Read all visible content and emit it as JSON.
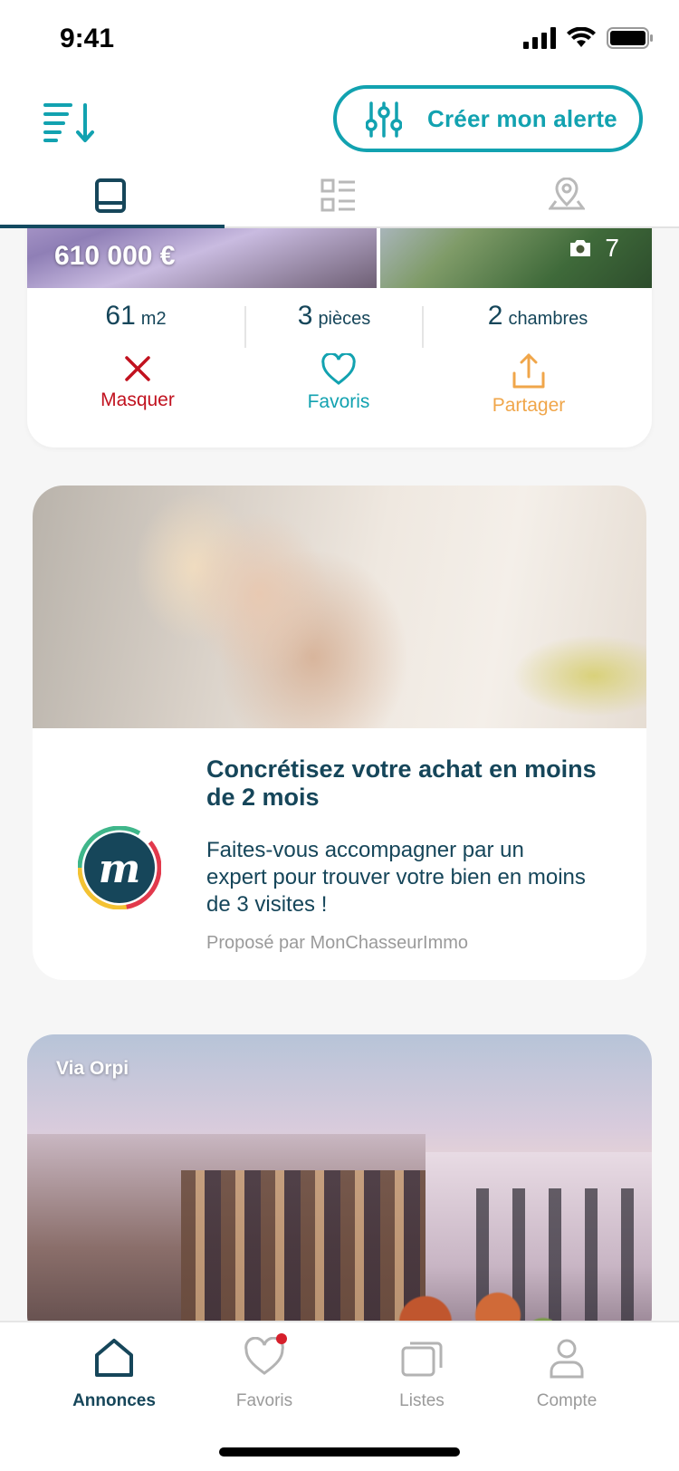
{
  "status_bar": {
    "time": "9:41"
  },
  "header": {
    "alert_label": "Créer mon alerte"
  },
  "view_tabs": [
    "card-view",
    "list-view",
    "map-view"
  ],
  "listing": {
    "price": "610 000 €",
    "photo_count": "7",
    "stats": [
      {
        "value": "61",
        "unit": "m2"
      },
      {
        "value": "3",
        "unit": "pièces"
      },
      {
        "value": "2",
        "unit": "chambres"
      }
    ],
    "actions": {
      "hide": "Masquer",
      "favorite": "Favoris",
      "share": "Partager"
    }
  },
  "promo": {
    "title": "Concrétisez votre achat en moins de 2 mois",
    "text": "Faites-vous accompagner par un expert pour trouver votre bien en moins de 3 visites !",
    "source": "Proposé par MonChasseurImmo"
  },
  "listing2": {
    "via": "Via Orpi"
  },
  "bottom_nav": {
    "items": [
      {
        "label": "Annonces",
        "icon": "home-icon",
        "active": true
      },
      {
        "label": "Favoris",
        "icon": "heart-icon",
        "active": false
      },
      {
        "label": "Listes",
        "icon": "cards-icon",
        "active": false
      },
      {
        "label": "Compte",
        "icon": "user-icon",
        "active": false
      }
    ]
  },
  "colors": {
    "teal": "#12a2b0",
    "navy": "#16465a",
    "red": "#c1121f",
    "orange": "#f0a64a",
    "badge": "#d61f2b"
  }
}
